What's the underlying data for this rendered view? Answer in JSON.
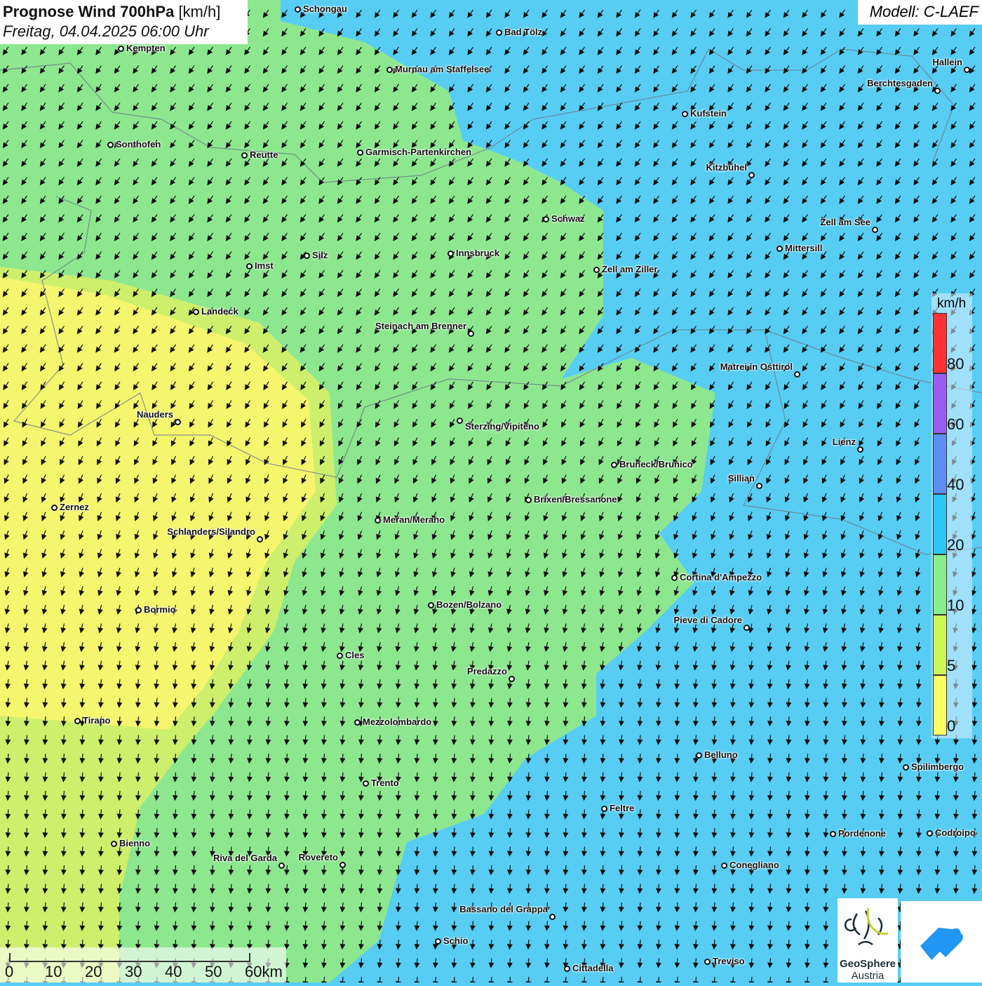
{
  "header": {
    "title_bold": "Prognose Wind 700hPa",
    "title_unit": "[km/h]",
    "subtitle": "Freitag, 04.04.2025 06:00 Uhr"
  },
  "model": "Modell: C-LAEF",
  "legend": {
    "unit": "km/h",
    "ticks": [
      "80",
      "60",
      "40",
      "20",
      "10",
      "5",
      "0"
    ],
    "colors": [
      "#ff3333",
      "#9b5cf2",
      "#5b8ff5",
      "#2ec6f5",
      "#88f08a",
      "#ccf55a",
      "#ffff66"
    ]
  },
  "scale": {
    "labels": [
      "0",
      "10",
      "20",
      "30",
      "40",
      "50",
      "60km"
    ]
  },
  "logos": {
    "geosphere_line1": "GeoSphere",
    "geosphere_line2": "Austria"
  },
  "cities": [
    "Schongau",
    "Bad Tölz",
    "Kempten",
    "Murnau am Staffelsee",
    "Hallein",
    "Berchtesgaden",
    "Kufstein",
    "Sonthofen",
    "Reutte",
    "Garmisch-Partenkirchen",
    "Kitzbühel",
    "Schwaz",
    "Zell am See",
    "Mittersill",
    "Innsbruck",
    "Silz",
    "Imst",
    "Zell am Ziller",
    "Landeck",
    "Steinach am Brenner",
    "Matrei in Osttirol",
    "Nauders",
    "Sterzing/Vipiteno",
    "Lienz",
    "Bruneck/Brunico",
    "Sillian",
    "Brixen/Bressanone",
    "Zernez",
    "Meran/Merano",
    "Schlanders/Silandro",
    "Cortina d'Ampezzo",
    "Bozen/Bolzano",
    "Bormio",
    "Pieve di Cadore",
    "Cles",
    "Predazzo",
    "Tirano",
    "Mezzolombardo",
    "Belluno",
    "Spilimbergo",
    "Trento",
    "Feltre",
    "Pordenone",
    "Codroipo",
    "Bienno",
    "Riva del Garda",
    "Rovereto",
    "Conegliano",
    "Bassano del Grappa",
    "Schio",
    "Treviso",
    "Cittadella"
  ]
}
